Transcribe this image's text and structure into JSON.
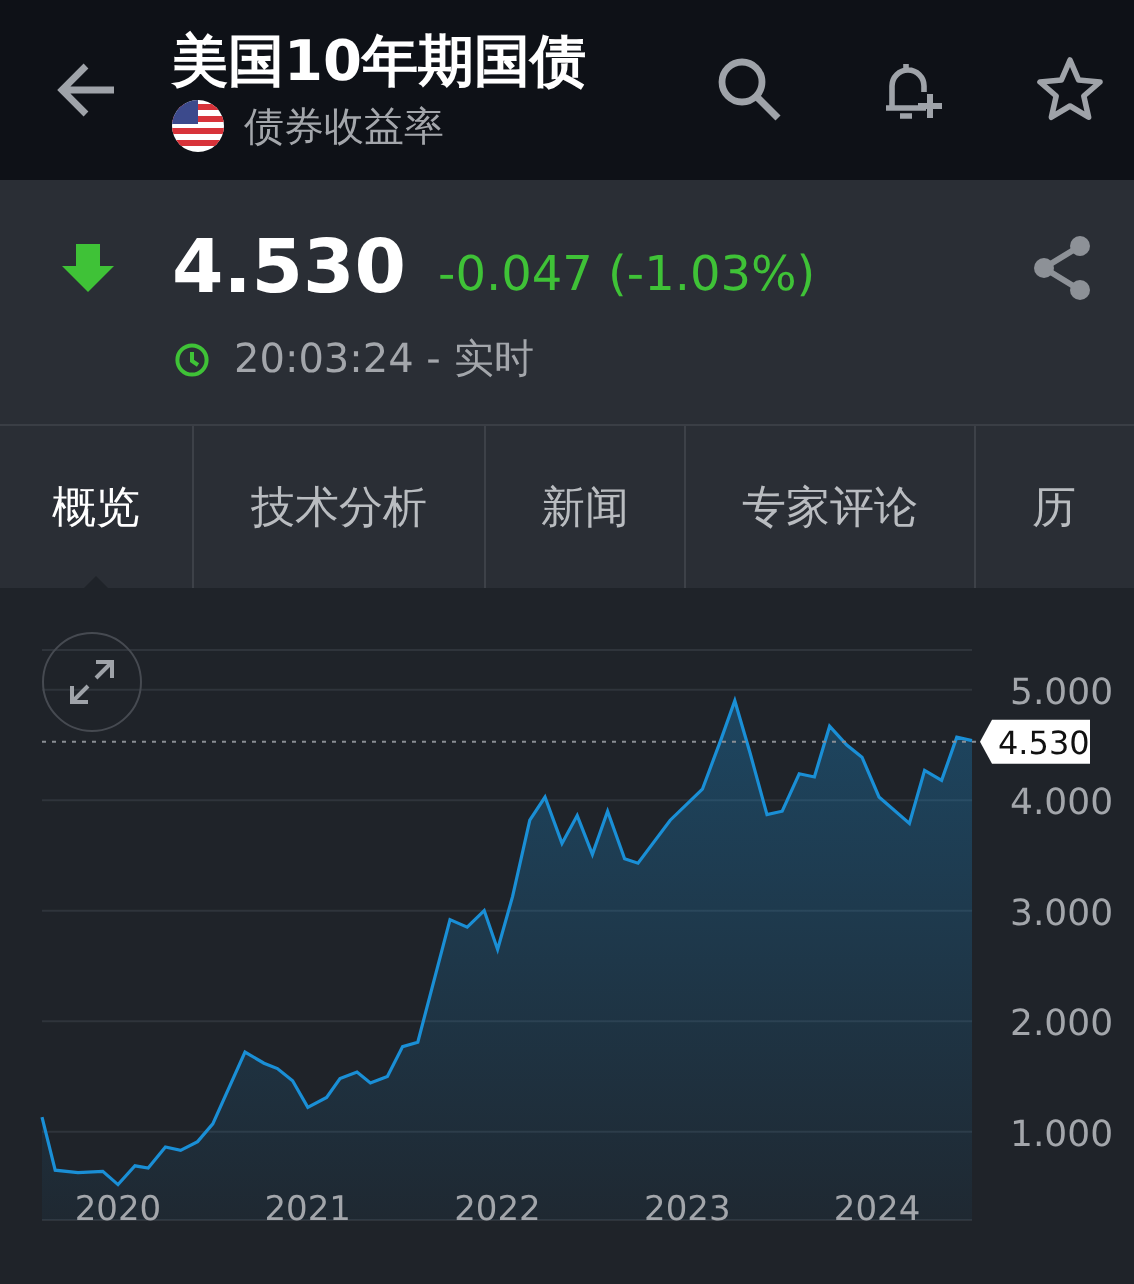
{
  "header": {
    "title": "美国10年期国债",
    "subtitle": "债券收益率"
  },
  "quote": {
    "falling": true,
    "price": "4.530",
    "change": "-0.047 (-1.03%)",
    "time": "20:03:24 - 实时"
  },
  "tabs": [
    {
      "label": "概览",
      "selected": true
    },
    {
      "label": "技术分析",
      "selected": false
    },
    {
      "label": "新闻",
      "selected": false
    },
    {
      "label": "专家评论",
      "selected": false
    },
    {
      "label": "历",
      "selected": false
    }
  ],
  "chart": {
    "chart_data": {
      "type": "area",
      "grid": true,
      "x": [
        2019.6,
        2019.67,
        2019.79,
        2019.92,
        2020.0,
        2020.09,
        2020.16,
        2020.25,
        2020.33,
        2020.42,
        2020.5,
        2020.67,
        2020.77,
        2020.84,
        2020.92,
        2021.0,
        2021.1,
        2021.17,
        2021.26,
        2021.33,
        2021.42,
        2021.5,
        2021.58,
        2021.75,
        2021.84,
        2021.93,
        2022.0,
        2022.08,
        2022.17,
        2022.25,
        2022.34,
        2022.42,
        2022.5,
        2022.58,
        2022.67,
        2022.74,
        2022.91,
        2023.08,
        2023.18,
        2023.25,
        2023.33,
        2023.42,
        2023.5,
        2023.59,
        2023.67,
        2023.75,
        2023.84,
        2023.92,
        2024.01,
        2024.17,
        2024.25,
        2024.34,
        2024.42,
        2024.5
      ],
      "series": [
        {
          "color": "#1a8fd6",
          "values": [
            1.13,
            0.65,
            0.63,
            0.64,
            0.52,
            0.69,
            0.67,
            0.86,
            0.83,
            0.91,
            1.07,
            1.72,
            1.62,
            1.57,
            1.46,
            1.22,
            1.31,
            1.48,
            1.54,
            1.44,
            1.5,
            1.77,
            1.81,
            2.92,
            2.85,
            3.0,
            2.65,
            3.13,
            3.82,
            4.03,
            3.61,
            3.86,
            3.51,
            3.9,
            3.47,
            3.43,
            3.82,
            4.1,
            4.56,
            4.9,
            4.43,
            3.87,
            3.9,
            4.24,
            4.21,
            4.67,
            4.5,
            4.39,
            4.03,
            3.79,
            4.27,
            4.18,
            4.57,
            4.54
          ]
        }
      ],
      "xlim": [
        2019.6,
        2024.5
      ],
      "ylim": [
        0.2,
        5.36
      ],
      "xticks": [
        {
          "value": 2020,
          "label": "2020"
        },
        {
          "value": 2021,
          "label": "2021"
        },
        {
          "value": 2022,
          "label": "2022"
        },
        {
          "value": 2023,
          "label": "2023"
        },
        {
          "value": 2024,
          "label": "2024"
        }
      ],
      "yticks": [
        {
          "value": 1,
          "label": "1.000"
        },
        {
          "value": 2,
          "label": "2.000"
        },
        {
          "value": 3,
          "label": "3.000"
        },
        {
          "value": 4,
          "label": "4.000"
        },
        {
          "value": 5,
          "label": "5.000"
        }
      ],
      "ref_lines": [
        {
          "axis": "y",
          "value": 4.53,
          "label": "4.530"
        }
      ]
    }
  }
}
